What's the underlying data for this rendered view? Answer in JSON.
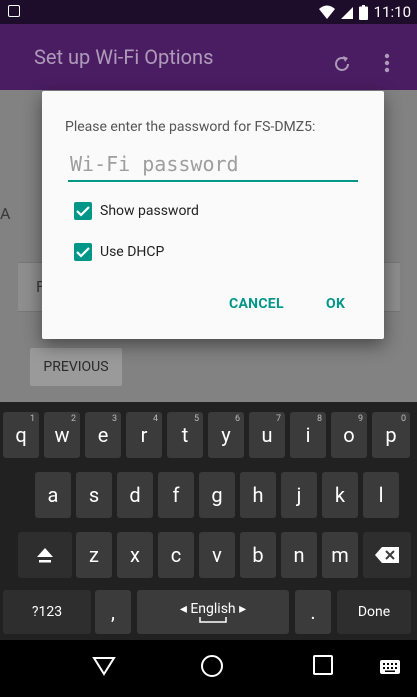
{
  "status": {
    "time": "11:10"
  },
  "app_bar": {
    "title": "Set up Wi-Fi Options"
  },
  "background": {
    "fragment_a": "A",
    "fragment_f": "F",
    "previous_label": "PREVIOUS"
  },
  "dialog": {
    "message": "Please enter the password for FS-DMZ5:",
    "password_placeholder": "Wi-Fi password",
    "password_value": "",
    "show_password": {
      "label": "Show password",
      "checked": true
    },
    "use_dhcp": {
      "label": "Use DHCP",
      "checked": true
    },
    "cancel_label": "CANCEL",
    "ok_label": "OK"
  },
  "keyboard": {
    "row1": [
      {
        "key": "q",
        "hint": "1"
      },
      {
        "key": "w",
        "hint": "2"
      },
      {
        "key": "e",
        "hint": "3"
      },
      {
        "key": "r",
        "hint": "4"
      },
      {
        "key": "t",
        "hint": "5"
      },
      {
        "key": "y",
        "hint": "6"
      },
      {
        "key": "u",
        "hint": "7"
      },
      {
        "key": "i",
        "hint": "8"
      },
      {
        "key": "o",
        "hint": "9"
      },
      {
        "key": "p",
        "hint": "0"
      }
    ],
    "row2": [
      "a",
      "s",
      "d",
      "f",
      "g",
      "h",
      "j",
      "k",
      "l"
    ],
    "row3": [
      "z",
      "x",
      "c",
      "v",
      "b",
      "n",
      "m"
    ],
    "symbols_label": "?123",
    "comma_label": ",",
    "space_label": "◂ English ▸",
    "period_label": ".",
    "done_label": "Done"
  },
  "colors": {
    "accent": "#009688",
    "app_bar": "#4a1d63",
    "status_bar": "#1e0c2b"
  }
}
